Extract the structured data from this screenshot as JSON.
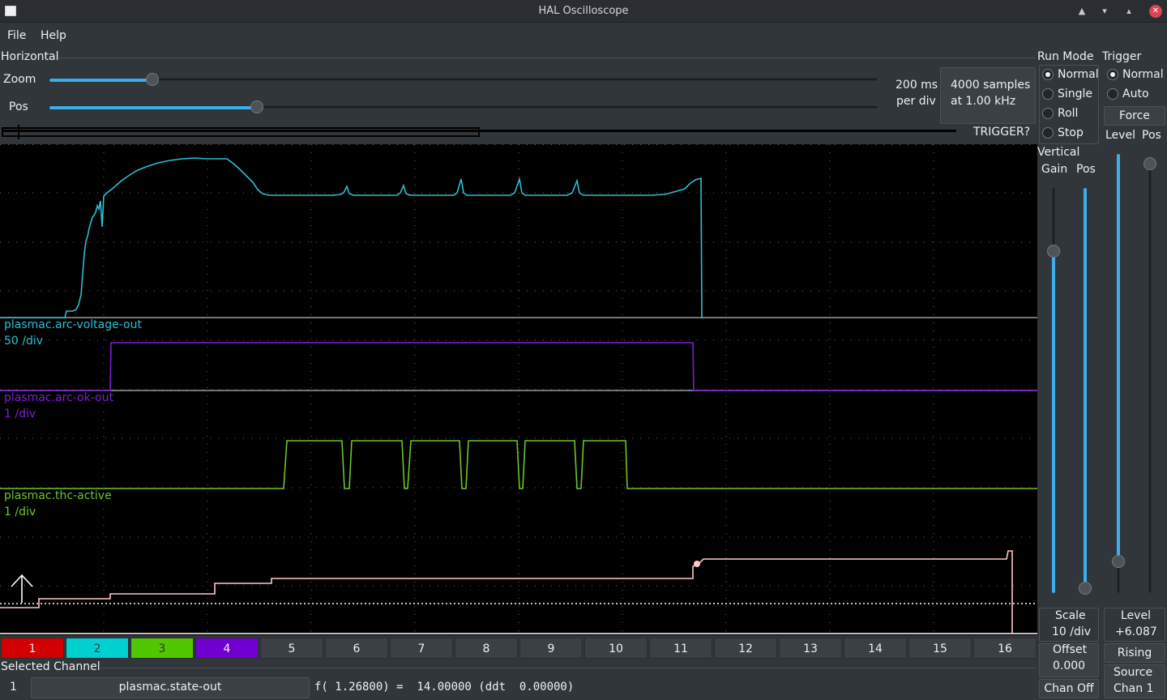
{
  "window": {
    "title": "HAL Oscilloscope"
  },
  "menu": {
    "file": "File",
    "help": "Help"
  },
  "horizontal": {
    "label": "Horizontal",
    "zoom_label": "Zoom",
    "pos_label": "Pos",
    "zoom_value": 0.1,
    "pos_value": 0.25,
    "scale_line1": "200 ms",
    "scale_line2": "per div",
    "samples_line1": "4000 samples",
    "samples_line2": "at 1.00 kHz",
    "trigger_status": "TRIGGER?"
  },
  "run_mode": {
    "label": "Run Mode",
    "options": [
      "Normal",
      "Single",
      "Roll",
      "Stop"
    ],
    "selected": "Normal"
  },
  "trigger": {
    "label": "Trigger",
    "options": [
      "Normal",
      "Auto"
    ],
    "selected": "Normal",
    "force_label": "Force",
    "level_header": "Level",
    "pos_header": "Pos",
    "level_label": "Level",
    "level_value": "+6.087",
    "edge_button": "Rising",
    "source_label": "Source",
    "source_value": "Chan  1"
  },
  "vertical": {
    "label": "Vertical",
    "gain_header": "Gain",
    "pos_header": "Pos",
    "scale_label": "Scale",
    "scale_value": "10 /div",
    "offset_label": "Offset",
    "offset_value": "0.000",
    "chan_off_button": "Chan Off"
  },
  "traces": [
    {
      "name": "plasmac.arc-voltage-out",
      "scale": "50 /div",
      "color": "#2ac0d0"
    },
    {
      "name": "plasmac.arc-ok-out",
      "scale": "1 /div",
      "color": "#7d1fd6"
    },
    {
      "name": "plasmac.thc-active",
      "scale": "1 /div",
      "color": "#6cc627"
    }
  ],
  "channels": {
    "labels": [
      "1",
      "2",
      "3",
      "4",
      "5",
      "6",
      "7",
      "8",
      "9",
      "10",
      "11",
      "12",
      "13",
      "14",
      "15",
      "16"
    ],
    "colors": [
      "#d20000",
      "#00d0d0",
      "#50c800",
      "#7000d0"
    ]
  },
  "selected_channel": {
    "label": "Selected Channel",
    "number": "1",
    "name": "plasmac.state-out",
    "readout": "f( 1.26800) =  14.00000 (ddt  0.00000)"
  }
}
